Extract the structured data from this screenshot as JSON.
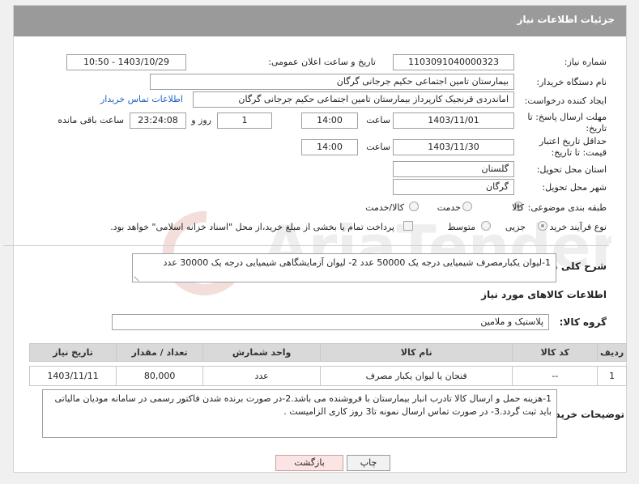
{
  "header": {
    "title": "جزئیات اطلاعات نیاز"
  },
  "fields": {
    "need_number": {
      "label": "شماره نیاز:",
      "value": "1103091040000323"
    },
    "announce_datetime": {
      "label": "تاریخ و ساعت اعلان عمومی:",
      "value": "1403/10/29 - 10:50"
    },
    "buyer_org": {
      "label": "نام دستگاه خریدار:",
      "value": "بیمارستان تامین اجتماعی حکیم جرجانی گرگان"
    },
    "requester": {
      "label": "ایجاد کننده درخواست:",
      "value": "اماندردی قرنجیک کارپرداز بیمارستان تامین اجتماعی حکیم جرجانی گرگان"
    },
    "buyer_contact_link": "اطلاعات تماس خریدار",
    "reply_deadline": {
      "label": "مهلت ارسال پاسخ: تا تاریخ:",
      "date": "1403/11/01",
      "time_label": "ساعت",
      "time": "14:00",
      "days": "1",
      "days_label": "روز و",
      "remaining": "23:24:08",
      "remaining_label": "ساعت باقی مانده"
    },
    "price_validity": {
      "label": "حداقل تاریخ اعتبار قیمت: تا تاریخ:",
      "date": "1403/11/30",
      "time_label": "ساعت",
      "time": "14:00"
    },
    "province": {
      "label": "استان محل تحویل:",
      "value": "گلستان"
    },
    "city": {
      "label": "شهر محل تحویل:",
      "value": "گرگان"
    },
    "category": {
      "label": "طبقه بندی موضوعی:",
      "options": [
        "کالا",
        "خدمت",
        "کالا/خدمت"
      ],
      "selected": "کالا"
    },
    "purchase_type": {
      "label": "نوع فرآیند خرید :",
      "options": [
        "جزیی",
        "متوسط"
      ],
      "selected": "جزیی",
      "note": "پرداخت تمام یا بخشی از مبلغ خرید،از محل \"اسناد خزانه اسلامی\" خواهد بود."
    }
  },
  "description": {
    "label": "شرح کلی نیاز:",
    "value": "1-لیوان یکبارمصرف شیمیایی درجه یک    50000 عدد 2- لیوان آزمایشگاهی شیمیایی درجه یک    30000  عدد"
  },
  "goods_info": {
    "title": "اطلاعات کالاهای مورد نیاز",
    "group_label": "گروه کالا:",
    "group_value": "پلاستیک و ملامین",
    "columns": [
      "ردیف",
      "کد کالا",
      "نام کالا",
      "واحد شمارش",
      "تعداد / مقدار",
      "تاریخ نیاز"
    ],
    "rows": [
      {
        "row": "1",
        "code": "--",
        "name": "فنجان یا لیوان یکبار مصرف",
        "unit": "عدد",
        "qty": "80,000",
        "date": "1403/11/11"
      }
    ]
  },
  "buyer_notes": {
    "label": "توضیحات خریدار:",
    "value": "1-هزینه حمل و ارسال کالا تادرب انبار بیمارستان با فروشنده می باشد.2-در صورت برنده شدن فاکتور رسمی در سامانه مودیان مالیاتی باید ثبت گردد.3- در صورت تماس ارسال نمونه تا3 روز کاری الزامیست ."
  },
  "buttons": {
    "print": "چاپ",
    "back": "بازگشت"
  },
  "watermark": "AriaTender.neT",
  "colors": {
    "header": "#9a9a9a",
    "link": "#1f5fbf",
    "back_button": "#fde4e4"
  }
}
